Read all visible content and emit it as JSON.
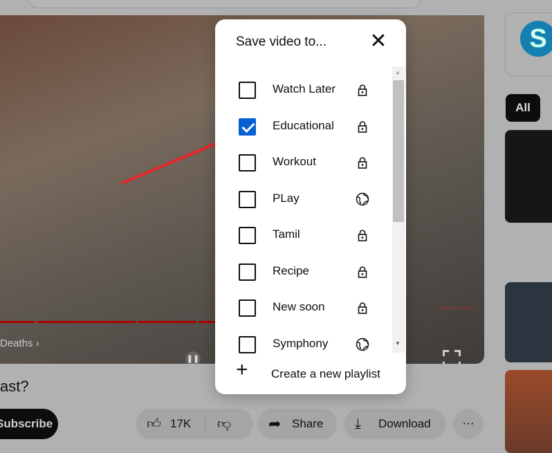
{
  "video": {
    "chapter": "Deaths ›",
    "watermark": "SIMPLE HISTORY",
    "title": "ast?"
  },
  "actions": {
    "subscribe": "Subscribe",
    "like_count": "17K",
    "share": "Share",
    "download": "Download",
    "more": "⋯"
  },
  "sidebar": {
    "chip_all": "All",
    "logo_letter": "S"
  },
  "dialog": {
    "title": "Save video to...",
    "close_icon": "close-icon",
    "playlists": [
      {
        "name": "Watch Later",
        "checked": false,
        "privacy": "private"
      },
      {
        "name": "Educational",
        "checked": true,
        "privacy": "private"
      },
      {
        "name": "Workout",
        "checked": false,
        "privacy": "private"
      },
      {
        "name": "PLay",
        "checked": false,
        "privacy": "public"
      },
      {
        "name": "Tamil",
        "checked": false,
        "privacy": "private"
      },
      {
        "name": "Recipe",
        "checked": false,
        "privacy": "private"
      },
      {
        "name": "New soon",
        "checked": false,
        "privacy": "private"
      },
      {
        "name": "Symphony",
        "checked": false,
        "privacy": "public"
      }
    ],
    "create_label": "Create a new playlist"
  },
  "colors": {
    "checkbox_checked": "#065fd4",
    "annotation_arrow": "#e8262a",
    "progress": "#b00000"
  }
}
